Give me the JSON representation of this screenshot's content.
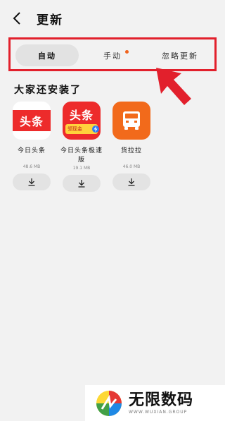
{
  "header": {
    "title": "更新"
  },
  "tabs": [
    {
      "label": "自动"
    },
    {
      "label": "手动"
    },
    {
      "label": "忽略更新"
    }
  ],
  "section": {
    "title": "大家还安装了"
  },
  "apps": [
    {
      "name": "今日头条",
      "size": "48.6 MB",
      "icon_text": "头条"
    },
    {
      "name": "今日头条极速版",
      "size": "19.1 MB",
      "icon_text": "头条",
      "icon_badge": "领现金"
    },
    {
      "name": "货拉拉",
      "size": "46.0 MB"
    }
  ],
  "watermark": {
    "title": "无限数码",
    "subtitle": "WWW.WUXIAN.GROUP"
  },
  "colors": {
    "highlight": "#e2202c",
    "accent_dot": "#f0641e",
    "toutiao_red": "#ed2b2b",
    "huolala_orange": "#f26a1b"
  }
}
